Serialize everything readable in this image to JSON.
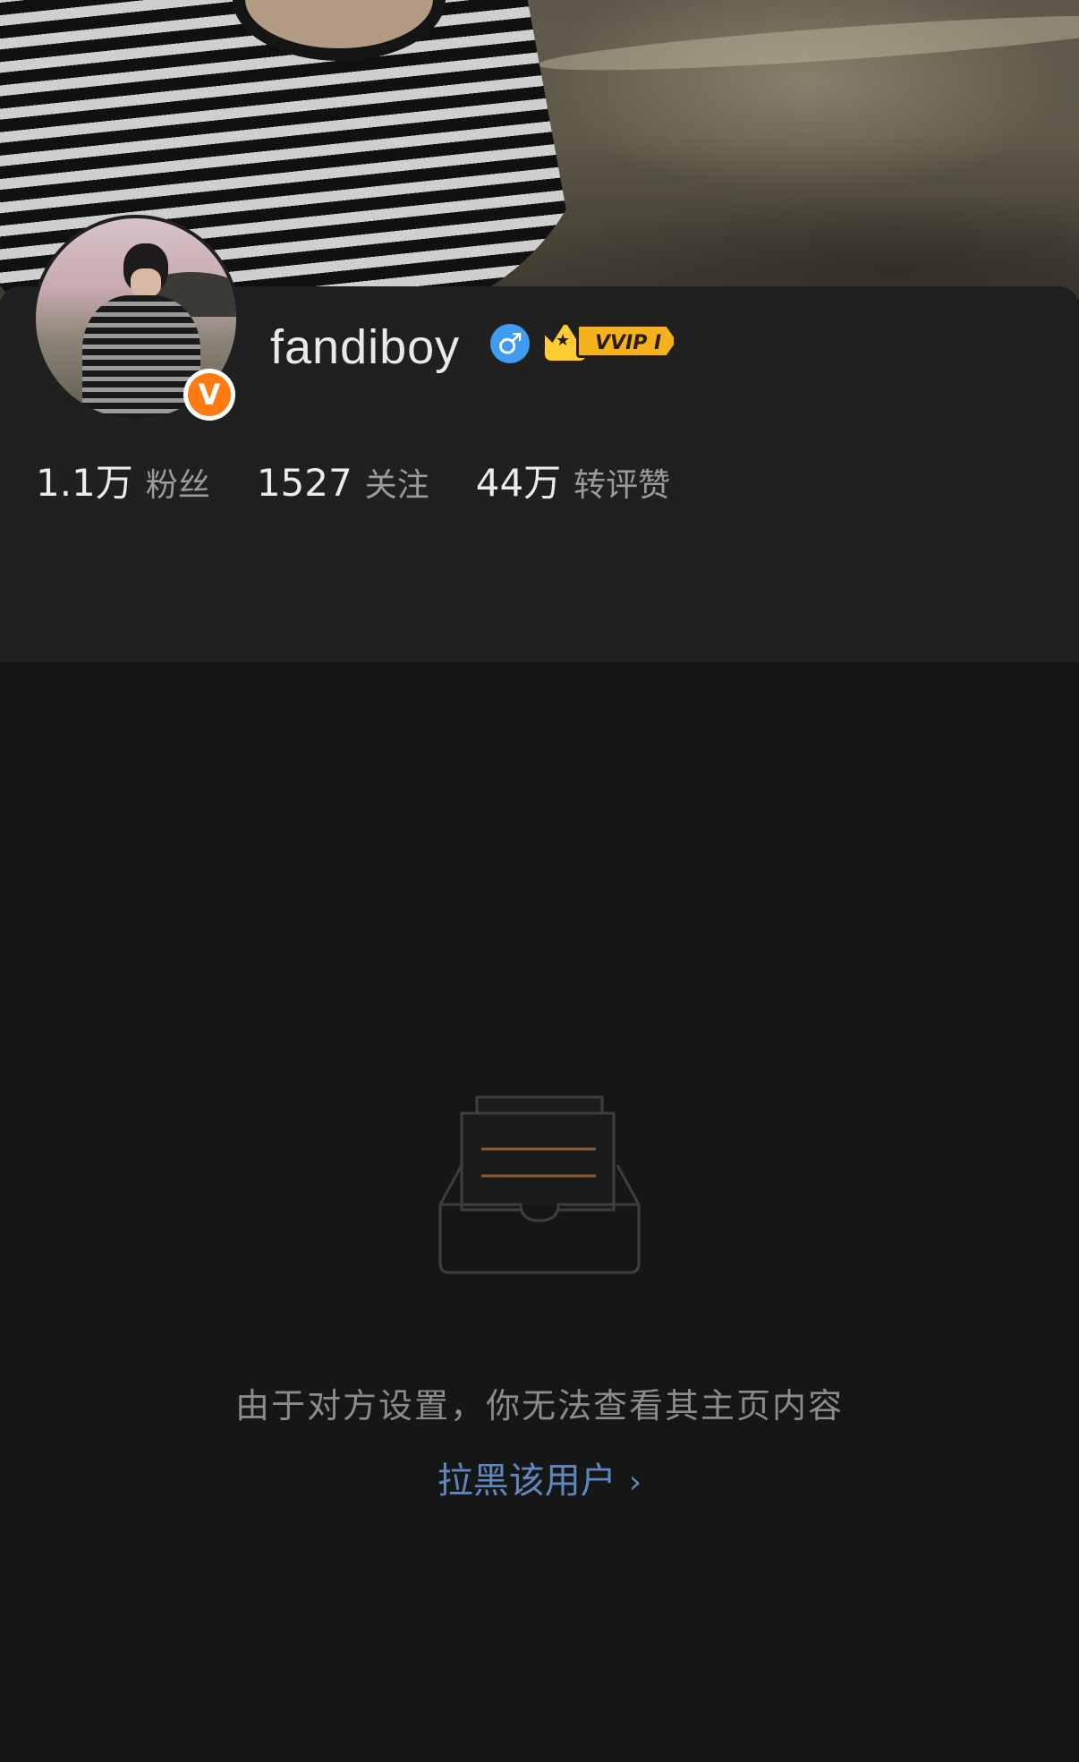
{
  "profile": {
    "username": "fandiboy",
    "gender_icon": "male-symbol-icon",
    "gender_symbol": "♂",
    "vip_badge": "VVIP I",
    "verified_badge": "V",
    "accent_color": "#ff7a10",
    "gender_color": "#3f9cf0"
  },
  "stats": [
    {
      "value": "1.1万",
      "label": "粉丝"
    },
    {
      "value": "1527",
      "label": "关注"
    },
    {
      "value": "44万",
      "label": "转评赞"
    }
  ],
  "empty_state": {
    "icon": "empty-inbox-icon",
    "message": "由于对方设置，你无法查看其主页内容",
    "block_link": "拉黑该用户",
    "block_link_chevron": "›",
    "link_color": "#5f86bd"
  }
}
